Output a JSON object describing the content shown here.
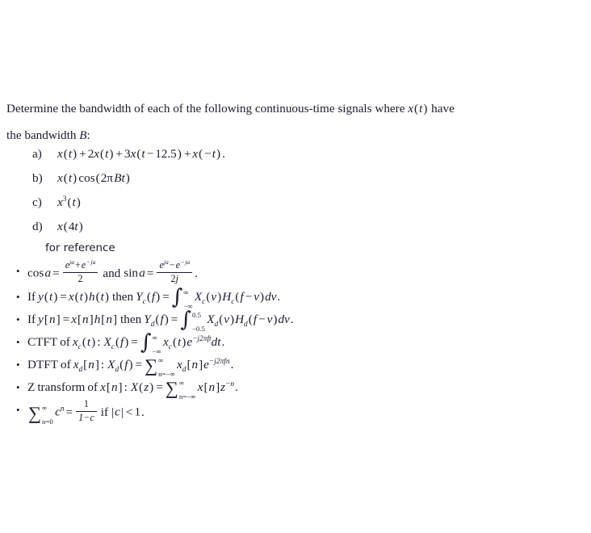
{
  "document": {
    "prompt": {
      "line1_pre": "Determine the bandwidth of each of the following continuous-time signals where ",
      "line1_math_x": "x",
      "line1_math_paren": "(",
      "line1_math_t": "t",
      "line1_math_paren_close": ")",
      "line1_post": " have",
      "line2_pre": "the bandwidth ",
      "line2_math_B": "B",
      "line2_post": ":"
    },
    "items": [
      {
        "label": "a)",
        "text": "x(t) + 2x(t) + 3x(t - 12.5) + x(-t).",
        "parts": {
          "x": "x",
          "t": "t",
          "plus": "+",
          "two": "2",
          "three": "3",
          "minus": "−",
          "delay": "12.5",
          "period": ".",
          "lparen": "(",
          "rparen": ")"
        }
      },
      {
        "label": "b)",
        "text": "x(t) cos(2πBt)",
        "parts": {
          "x": "x",
          "t": "t",
          "cos": "cos",
          "two": "2",
          "pi": "π",
          "B": "B",
          "lparen": "(",
          "rparen": ")"
        }
      },
      {
        "label": "c)",
        "text": "x³(t)",
        "parts": {
          "x": "x",
          "exp": "3",
          "t": "t",
          "lparen": "(",
          "rparen": ")"
        }
      },
      {
        "label": "d)",
        "text": "x(4t)",
        "parts": {
          "x": "x",
          "four": "4",
          "t": "t",
          "lparen": "(",
          "rparen": ")"
        }
      }
    ],
    "for_reference_label": "for reference",
    "bullet_glyph": "•",
    "references": [
      {
        "id": "euler",
        "text": "cos a = (e^{ja}+e^{-ja})/2 and sin a = (e^{ja}-e^{-ja})/(2j).",
        "parts": {
          "cos": "cos",
          "sin": "sin",
          "a": "a",
          "eq": "=",
          "and": "and",
          "e": "e",
          "j": "j",
          "plus": "+",
          "minus": "−",
          "den2": "2",
          "den2j": "2j",
          "period": "."
        }
      },
      {
        "id": "ct-convolution",
        "text": "If y(t) = x(t)h(t) then Y_c(f) = ∫_{-∞}^{∞} X_c(v)H_c(f - v)dv.",
        "parts": {
          "If": "If",
          "then": "then",
          "y": "y",
          "t": "t",
          "x": "x",
          "h": "h",
          "Y": "Y",
          "X": "X",
          "H": "H",
          "sub": "c",
          "f": "f",
          "v": "v",
          "eq": "=",
          "minus": "−",
          "dv": "dv",
          "period": ".",
          "int_hi": "∞",
          "int_lo": "−∞",
          "int_glyph": "∫"
        }
      },
      {
        "id": "dt-convolution",
        "text": "If y[n] = x[n]h[n] then Y_d(f) = ∫_{-0.5}^{0.5} X_d(v)H_d(f - v)dv.",
        "parts": {
          "If": "If",
          "then": "then",
          "y": "y",
          "n": "n",
          "x": "x",
          "h": "h",
          "Y": "Y",
          "X": "X",
          "H": "H",
          "sub": "d",
          "f": "f",
          "v": "v",
          "eq": "=",
          "minus": "−",
          "dv": "dv",
          "period": ".",
          "int_hi": "0.5",
          "int_lo": "−0.5",
          "int_glyph": "∫"
        }
      },
      {
        "id": "ctft",
        "text": "CTFT of x_c(t): X_c(f) = ∫_{-∞}^{∞} x_c(t)e^{-j2πft}dt.",
        "parts": {
          "name": "CTFT",
          "of": "of",
          "x": "x",
          "X": "X",
          "sub": "c",
          "t": "t",
          "f": "f",
          "colon": ":",
          "eq": "=",
          "e": "e",
          "exp": "−j2πft",
          "dt": "dt",
          "period": ".",
          "int_hi": "∞",
          "int_lo": "−∞",
          "int_glyph": "∫"
        }
      },
      {
        "id": "dtft",
        "text": "DTFT of x_d[n]: X_d(f) = Σ_{n=-∞}^{∞} x_d[n]e^{-j2πfn}.",
        "parts": {
          "name": "DTFT",
          "of": "of",
          "x": "x",
          "X": "X",
          "sub": "d",
          "n": "n",
          "f": "f",
          "colon": ":",
          "eq": "=",
          "e": "e",
          "exp": "−j2πfn",
          "period": ".",
          "sum_hi": "∞",
          "sum_lo": "n=−∞",
          "sum_glyph": "∑"
        }
      },
      {
        "id": "ztransform",
        "text": "Z transform of x[n]: X(z) = Σ_{n=-∞}^{∞} x[n]z^{-n}.",
        "parts": {
          "name": "Z",
          "transform": "transform",
          "of": "of",
          "x": "x",
          "X": "X",
          "z": "z",
          "n": "n",
          "colon": ":",
          "eq": "=",
          "exp": "−n",
          "period": ".",
          "sum_hi": "∞",
          "sum_lo": "n=−∞",
          "sum_glyph": "∑"
        }
      },
      {
        "id": "geometric-series",
        "text": "Σ_{n=0}^{∞} c^n = 1/(1-c) if |c| < 1.",
        "parts": {
          "c": "c",
          "n": "n",
          "eq": "=",
          "if": "if",
          "one_num": "1",
          "den": "1−c",
          "abs": "|",
          "lt": "<",
          "one": "1",
          "period": ".",
          "sum_hi": "∞",
          "sum_lo": "n=0",
          "sum_glyph": "∑"
        }
      }
    ]
  },
  "style": {
    "background": "#ffffff",
    "text_color": "#1b1b2e"
  }
}
